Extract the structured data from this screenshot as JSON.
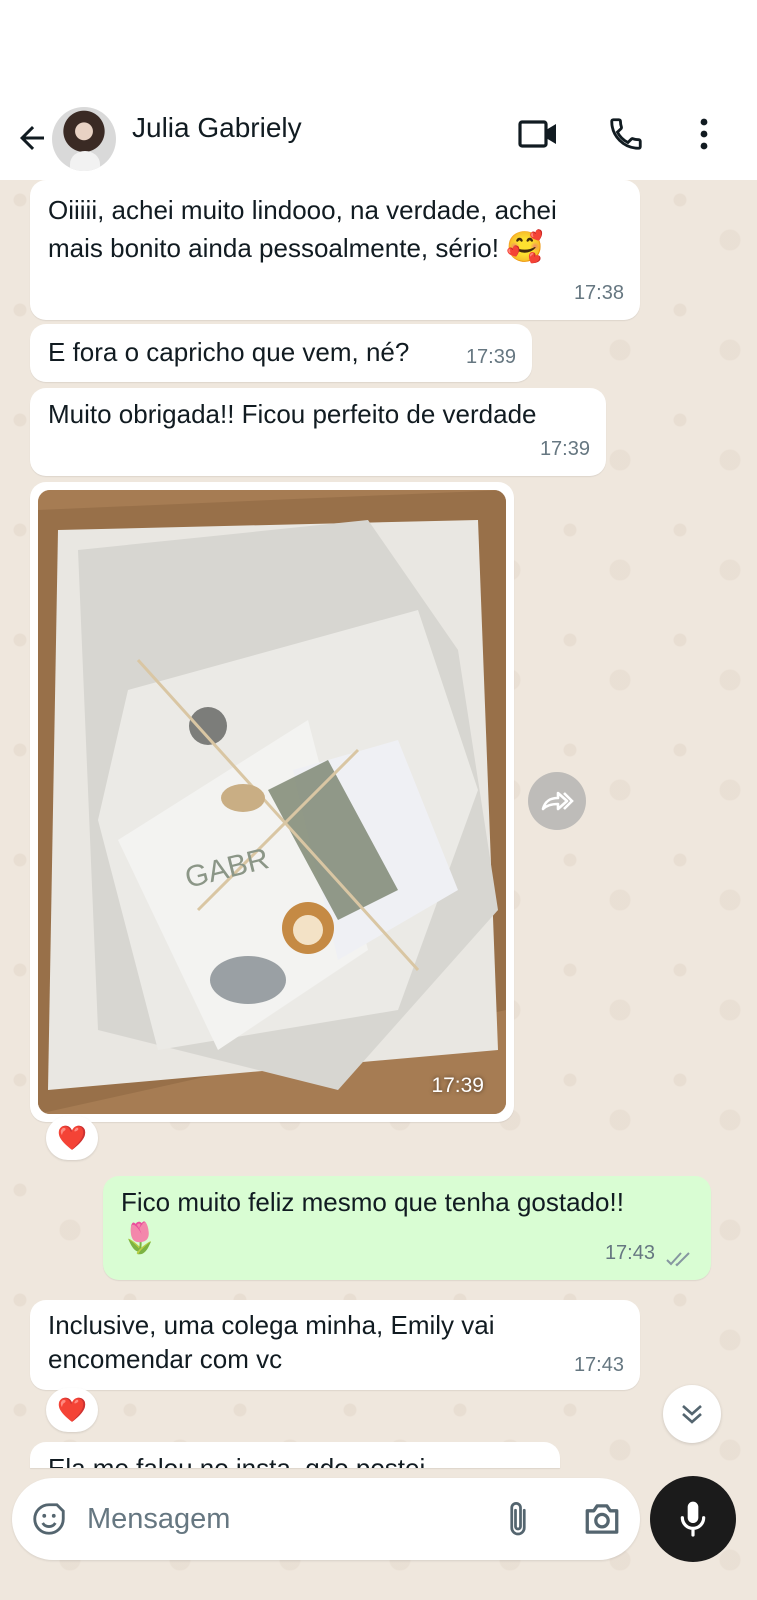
{
  "header": {
    "contact_name": "Julia Gabriely",
    "back_icon": "arrow-left-icon",
    "video_icon": "video-camera-icon",
    "call_icon": "phone-icon",
    "menu_icon": "more-vertical-icon"
  },
  "messages": [
    {
      "text_line1": "Oiiiii, achei muito lindooo, na verdade, achei",
      "text_line2": "mais bonito ainda pessoalmente, sério!",
      "emoji": "🥰",
      "time": "17:38"
    },
    {
      "text": "E fora o capricho que vem, né?",
      "time": "17:39"
    },
    {
      "text": "Muito obrigada!! Ficou perfeito de verdade",
      "time": "17:39"
    },
    {
      "type": "photo",
      "time": "17:39",
      "reaction": "❤️"
    },
    {
      "text": "Fico muito feliz mesmo que tenha gostado!!",
      "emoji": "🌷",
      "time": "17:43",
      "outgoing": true,
      "status_icon": "double-check-icon"
    },
    {
      "text_line1": "Inclusive, uma colega minha, Emily vai",
      "text_line2": "encomendar com vc",
      "time": "17:43",
      "reaction": "❤️"
    },
    {
      "text": "Ela me falou no insta, qdo postei"
    }
  ],
  "composer": {
    "placeholder": "Mensagem",
    "sticker_icon": "sticker-icon",
    "attach_icon": "paperclip-icon",
    "camera_icon": "camera-icon",
    "mic_icon": "microphone-icon"
  },
  "colors": {
    "chat_background": "#efe7dd",
    "incoming_bubble": "#ffffff",
    "outgoing_bubble": "#d9fdd3",
    "timestamp": "#667781",
    "reaction_heart": "#e0252e"
  }
}
